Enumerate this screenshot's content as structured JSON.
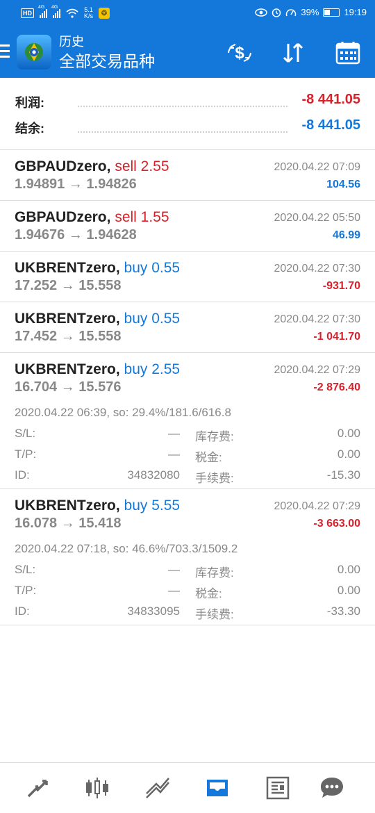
{
  "status_bar": {
    "hd": "HD",
    "sig1": "4G",
    "sig2": "4G",
    "net_speed": "5.1",
    "net_unit": "K/s",
    "battery": "39%",
    "time": "19:19"
  },
  "header": {
    "subtitle": "历史",
    "title": "全部交易品种",
    "icons": [
      "menu-icon",
      "currency-exchange-icon",
      "sort-icon",
      "calendar-icon"
    ]
  },
  "summary": {
    "profit_label": "利润:",
    "profit_value": "-8 441.05",
    "balance_label": "结余:",
    "balance_value": "-8 441.05"
  },
  "trades": [
    {
      "symbol": "GBPAUDzero,",
      "side": "sell 2.55",
      "prices": "1.94891 → 1.94826",
      "time": "2020.04.22 07:09",
      "profit": "104.56"
    },
    {
      "symbol": "GBPAUDzero,",
      "side": "sell 1.55",
      "prices": "1.94676 → 1.94628",
      "time": "2020.04.22 05:50",
      "profit": "46.99"
    },
    {
      "symbol": "UKBRENTzero,",
      "side": "buy 0.55",
      "prices": "17.252 → 15.558",
      "time": "2020.04.22 07:30",
      "profit": "-931.70"
    },
    {
      "symbol": "UKBRENTzero,",
      "side": "buy 0.55",
      "prices": "17.452 → 15.558",
      "time": "2020.04.22 07:30",
      "profit": "-1 041.70"
    },
    {
      "symbol": "UKBRENTzero,",
      "side": "buy 2.55",
      "prices": "16.704 → 15.576",
      "time": "2020.04.22 07:29",
      "profit": "-2 876.40",
      "detail": "2020.04.22 06:39, so: 29.4%/181.6/616.8",
      "sl_label": "S/L:",
      "sl_value": "—",
      "swap_label": "库存费:",
      "swap_value": "0.00",
      "tp_label": "T/P:",
      "tp_value": "—",
      "tax_label": "税金:",
      "tax_value": "0.00",
      "id_label": "ID:",
      "id_value": "34832080",
      "fee_label": "手续费:",
      "fee_value": "-15.30"
    },
    {
      "symbol": "UKBRENTzero,",
      "side": "buy 5.55",
      "prices": "16.078 → 15.418",
      "time": "2020.04.22 07:29",
      "profit": "-3 663.00",
      "detail": "2020.04.22 07:18, so: 46.6%/703.3/1509.2",
      "sl_label": "S/L:",
      "sl_value": "—",
      "swap_label": "库存费:",
      "swap_value": "0.00",
      "tp_label": "T/P:",
      "tp_value": "—",
      "tax_label": "税金:",
      "tax_value": "0.00",
      "id_label": "ID:",
      "id_value": "34833095",
      "fee_label": "手续费:",
      "fee_value": "-33.30"
    }
  ],
  "bottom_nav": {
    "items": [
      "quotes-icon",
      "chart-icon",
      "trade-icon",
      "history-icon",
      "news-icon",
      "messages-icon"
    ],
    "active": "history-icon"
  },
  "colors": {
    "primary": "#1478db",
    "loss": "#d8222b",
    "muted": "#888888"
  }
}
